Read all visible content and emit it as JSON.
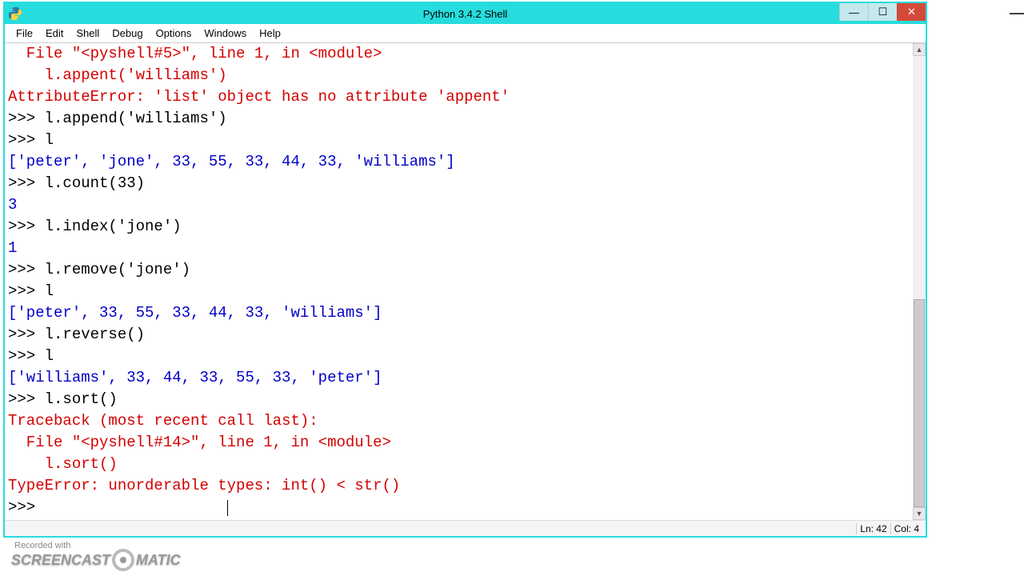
{
  "window": {
    "title": "Python 3.4.2 Shell"
  },
  "menu": {
    "file": "File",
    "edit": "Edit",
    "shell": "Shell",
    "debug": "Debug",
    "options": "Options",
    "windows": "Windows",
    "help": "Help"
  },
  "lines": {
    "l0": "  File \"<pyshell#5>\", line 1, in <module>",
    "l1": "    l.appent('williams')",
    "l2": "AttributeError: 'list' object has no attribute 'appent'",
    "p3": ">>> ",
    "c3": "l.append('williams')",
    "p4": ">>> ",
    "c4": "l",
    "o5": "['peter', 'jone', 33, 55, 33, 44, 33, 'williams']",
    "p6": ">>> ",
    "c6": "l.count(33)",
    "o7": "3",
    "p8": ">>> ",
    "c8": "l.index('jone')",
    "o9": "1",
    "p10": ">>> ",
    "c10": "l.remove('jone')",
    "p11": ">>> ",
    "c11": "l",
    "o12": "['peter', 33, 55, 33, 44, 33, 'williams']",
    "p13": ">>> ",
    "c13": "l.reverse()",
    "p14": ">>> ",
    "c14": "l",
    "o15": "['williams', 33, 44, 33, 55, 33, 'peter']",
    "p16": ">>> ",
    "c16": "l.sort()",
    "e17": "Traceback (most recent call last):",
    "e18": "  File \"<pyshell#14>\", line 1, in <module>",
    "e19": "    l.sort()",
    "e20": "TypeError: unorderable types: int() < str()",
    "p21": ">>> "
  },
  "status": {
    "ln": "Ln: 42",
    "col": "Col: 4"
  },
  "watermark": {
    "label": "Recorded with",
    "left": "SCREENCAST",
    "right": "MATIC"
  },
  "controls": {
    "min": "—",
    "max": "☐",
    "close": "✕"
  }
}
